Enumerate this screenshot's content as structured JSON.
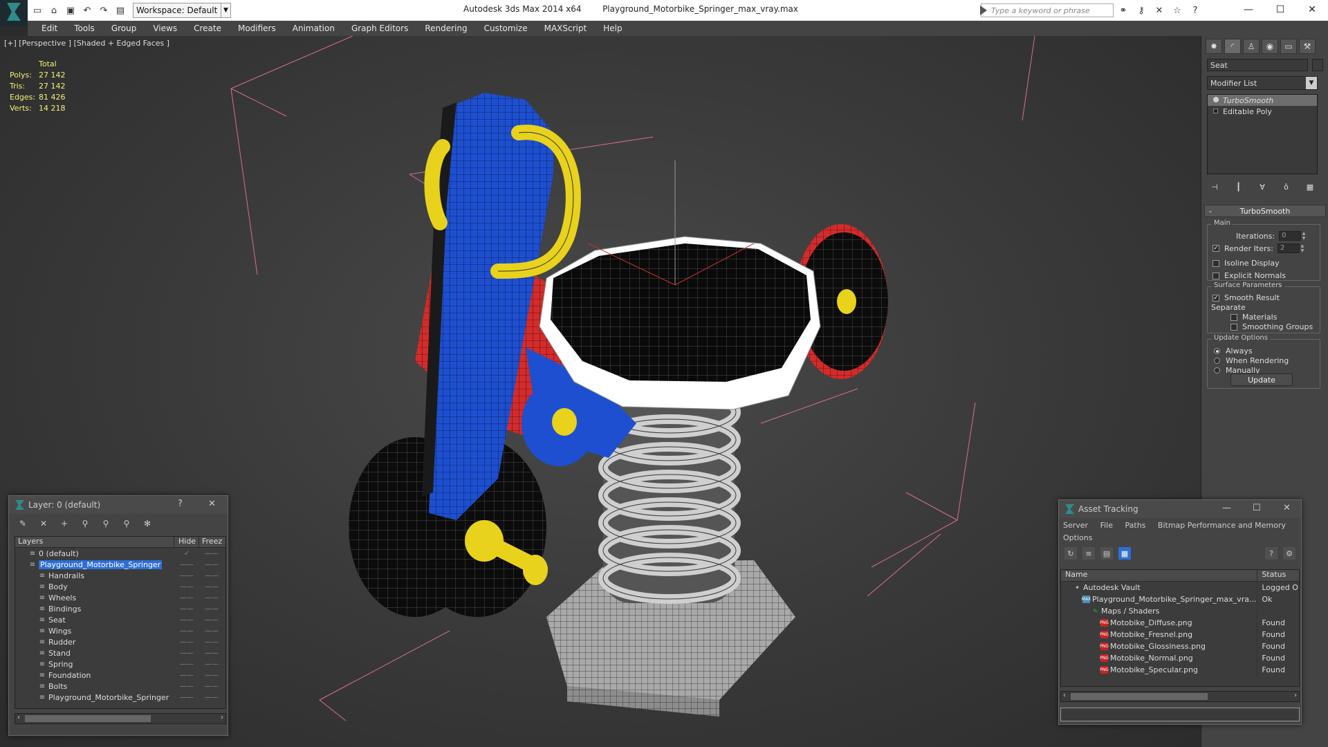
{
  "titlebar": {
    "workspace": "Workspace: Default",
    "app_title": "Autodesk 3ds Max 2014 x64",
    "file_title": "Playground_Motorbike_Springer_max_vray.max",
    "search_placeholder": "Type a keyword or phrase"
  },
  "menu": [
    "Edit",
    "Tools",
    "Group",
    "Views",
    "Create",
    "Modifiers",
    "Animation",
    "Graph Editors",
    "Rendering",
    "Customize",
    "MAXScript",
    "Help"
  ],
  "viewport": {
    "label": "[+] [Perspective ] [Shaded + Edged Faces ]",
    "stats": {
      "header": "Total",
      "rows": [
        {
          "k": "Polys:",
          "v": "27 142"
        },
        {
          "k": "Tris:",
          "v": "27 142"
        },
        {
          "k": "Edges:",
          "v": "81 426"
        },
        {
          "k": "Verts:",
          "v": "14 218"
        }
      ]
    }
  },
  "command_panel": {
    "object_name": "Seat",
    "modifier_list": "Modifier List",
    "stack": [
      "TurboSmooth",
      "Editable Poly"
    ],
    "rollout_title": "TurboSmooth",
    "main_group": "Main",
    "iterations_label": "Iterations:",
    "iterations_value": "0",
    "render_iters_label": "Render Iters:",
    "render_iters_value": "2",
    "isoline": "Isoline Display",
    "explicit_normals": "Explicit Normals",
    "surface_group": "Surface Parameters",
    "smooth_result": "Smooth Result",
    "separate": "Separate",
    "materials": "Materials",
    "smoothing_groups": "Smoothing Groups",
    "update_group": "Update Options",
    "always": "Always",
    "when_rendering": "When Rendering",
    "manually": "Manually",
    "update_btn": "Update"
  },
  "layer_panel": {
    "title": "Layer: 0 (default)",
    "help": "?",
    "columns": [
      "Layers",
      "Hide",
      "Freez"
    ],
    "rows": [
      {
        "name": "0 (default)",
        "level": 0,
        "check": "✓"
      },
      {
        "name": "Playground_Motorbike_Springer",
        "level": 0,
        "selected": true
      },
      {
        "name": "Handrails",
        "level": 1
      },
      {
        "name": "Body",
        "level": 1
      },
      {
        "name": "Wheels",
        "level": 1
      },
      {
        "name": "Bindings",
        "level": 1
      },
      {
        "name": "Seat",
        "level": 1
      },
      {
        "name": "Wings",
        "level": 1
      },
      {
        "name": "Rudder",
        "level": 1
      },
      {
        "name": "Stand",
        "level": 1
      },
      {
        "name": "Spring",
        "level": 1
      },
      {
        "name": "Foundation",
        "level": 1
      },
      {
        "name": "Bolts",
        "level": 1
      },
      {
        "name": "Playground_Motorbike_Springer",
        "level": 1
      }
    ]
  },
  "asset_panel": {
    "title": "Asset Tracking",
    "menu": [
      "Server",
      "File",
      "Paths",
      "Bitmap Performance and Memory",
      "Options"
    ],
    "columns": [
      "Name",
      "Status"
    ],
    "rows": [
      {
        "name": "Autodesk Vault",
        "status": "Logged O",
        "level": 0,
        "icon": "vault"
      },
      {
        "name": "Playground_Motorbike_Springer_max_vra...",
        "status": "Ok",
        "level": 1,
        "icon": "max"
      },
      {
        "name": "Maps / Shaders",
        "status": "",
        "level": 2,
        "icon": "folder"
      },
      {
        "name": "Motobike_Diffuse.png",
        "status": "Found",
        "level": 3,
        "icon": "png"
      },
      {
        "name": "Motobike_Fresnel.png",
        "status": "Found",
        "level": 3,
        "icon": "png"
      },
      {
        "name": "Motobike_Glossiness.png",
        "status": "Found",
        "level": 3,
        "icon": "png"
      },
      {
        "name": "Motobike_Normal.png",
        "status": "Found",
        "level": 3,
        "icon": "png"
      },
      {
        "name": "Motobike_Specular.png",
        "status": "Found",
        "level": 3,
        "icon": "png"
      }
    ]
  },
  "colors": {
    "accent": "#2d6fd6",
    "stats_text": "#f5f078",
    "model_blue": "#1e4fd0",
    "model_red": "#d42b2b",
    "model_yellow": "#e8d21c"
  }
}
